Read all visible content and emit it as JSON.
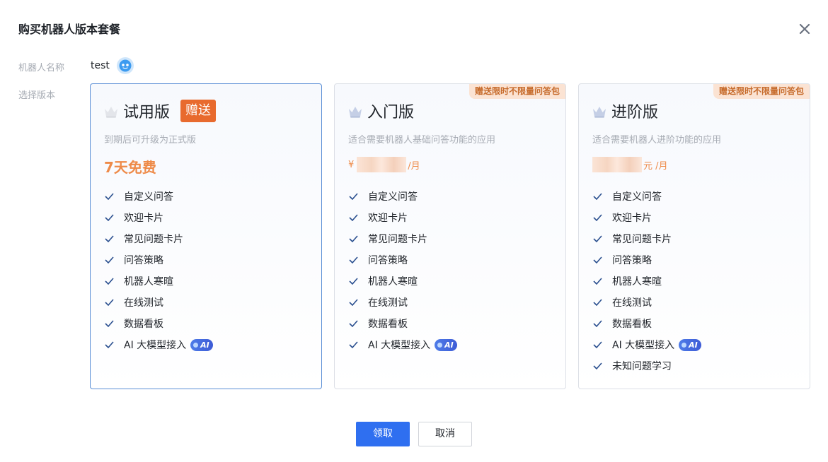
{
  "dialog": {
    "title": "购买机器人版本套餐"
  },
  "bot": {
    "name_label": "机器人名称",
    "name": "test",
    "version_label": "选择版本"
  },
  "plans": [
    {
      "name": "试用版",
      "gift_tag": "赠送",
      "description": "到期后可升级为正式版",
      "price_text": "7天免费",
      "selected": true,
      "features": [
        "自定义问答",
        "欢迎卡片",
        "常见问题卡片",
        "问答策略",
        "机器人寒暄",
        "在线测试",
        "数据看板",
        "AI 大模型接入"
      ]
    },
    {
      "name": "入门版",
      "ribbon": "赠送限时不限量问答包",
      "description": "适合需要机器人基础问答功能的应用",
      "currency": "¥",
      "price_unit": "/月",
      "selected": false,
      "features": [
        "自定义问答",
        "欢迎卡片",
        "常见问题卡片",
        "问答策略",
        "机器人寒暄",
        "在线测试",
        "数据看板",
        "AI 大模型接入"
      ]
    },
    {
      "name": "进阶版",
      "ribbon": "赠送限时不限量问答包",
      "description": "适合需要机器人进阶功能的应用",
      "price_unit": "元 /月",
      "selected": false,
      "features": [
        "自定义问答",
        "欢迎卡片",
        "常见问题卡片",
        "问答策略",
        "机器人寒暄",
        "在线测试",
        "数据看板",
        "AI 大模型接入",
        "未知问题学习"
      ]
    }
  ],
  "ai_badge": "AI",
  "footer": {
    "confirm_label": "领取",
    "cancel_label": "取消"
  },
  "colors": {
    "primary": "#2f6ff0",
    "price": "#ee8a48",
    "gift_tag": "#e86a2e",
    "ribbon_bg": "#fbe3d3",
    "check": "#2a4f8f"
  },
  "icons": {
    "close": "close-icon",
    "crown": "crown-icon",
    "check": "check-icon",
    "avatar": "robot-avatar-icon"
  }
}
